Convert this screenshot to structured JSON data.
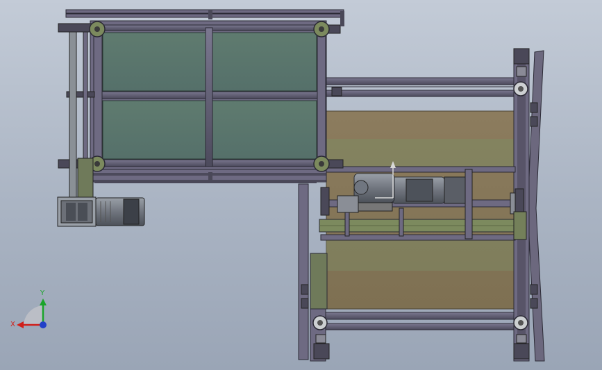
{
  "viewport": {
    "background_top": "#c3cbd7",
    "background_bottom": "#9aa5b6"
  },
  "colors": {
    "panel_green": "#5e7a6c",
    "frame_purple": "#6f6a82",
    "frame_dark": "#3e3d4a",
    "rail_olive": "#7e8a62",
    "floor_brown": "#8a7a5c",
    "motor_gray": "#8c8f96",
    "axis_x": "#d0201a",
    "axis_y": "#1aa42a",
    "axis_z": "#2240c8"
  },
  "triad": {
    "x_label": "X",
    "y_label": "Y",
    "icon": "coordinate-triad-icon"
  }
}
